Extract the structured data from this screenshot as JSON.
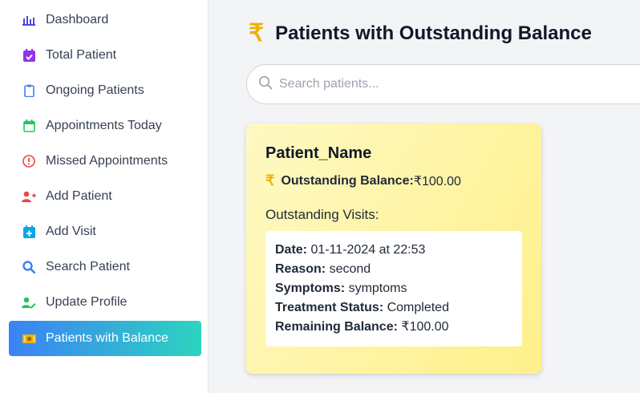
{
  "sidebar": {
    "items": [
      {
        "label": "Dashboard",
        "icon": "bar-chart-icon",
        "color": "#4f46e5"
      },
      {
        "label": "Total Patient",
        "icon": "calendar-check-icon",
        "color": "#9333ea"
      },
      {
        "label": "Ongoing Patients",
        "icon": "clipboard-icon",
        "color": "#3b82f6"
      },
      {
        "label": "Appointments Today",
        "icon": "calendar-icon",
        "color": "#22c55e"
      },
      {
        "label": "Missed Appointments",
        "icon": "alert-circle-icon",
        "color": "#ef4444"
      },
      {
        "label": "Add Patient",
        "icon": "user-plus-icon",
        "color": "#ef4444"
      },
      {
        "label": "Add Visit",
        "icon": "calendar-plus-icon",
        "color": "#0ea5e9"
      },
      {
        "label": "Search Patient",
        "icon": "search-icon",
        "color": "#3b82f6"
      },
      {
        "label": "Update Profile",
        "icon": "user-edit-icon",
        "color": "#22c55e"
      },
      {
        "label": "Patients with Balance",
        "icon": "money-icon",
        "color": "#eab308",
        "active": true
      }
    ]
  },
  "header": {
    "icon": "rupee-icon",
    "symbol": "₹",
    "title": "Patients with Outstanding Balance"
  },
  "search": {
    "placeholder": "Search patients...",
    "value": ""
  },
  "patient_card": {
    "name": "Patient_Name",
    "balance_symbol": "₹",
    "balance_label": "Outstanding Balance:",
    "balance_value": "₹100.00",
    "visits_title": "Outstanding Visits:",
    "visit": {
      "date_label": "Date:",
      "date_value": " 01-11-2024 at 22:53",
      "reason_label": "Reason:",
      "reason_value": " second",
      "symptoms_label": "Symptoms:",
      "symptoms_value": " symptoms",
      "status_label": "Treatment Status:",
      "status_value": " Completed",
      "remaining_label": "Remaining Balance:",
      "remaining_value": " ₹100.00"
    }
  },
  "colors": {
    "accent_gradient_start": "#3b82f6",
    "accent_gradient_end": "#2dd4bf",
    "rupee": "#eab308",
    "card_bg": "#fef9c3"
  }
}
